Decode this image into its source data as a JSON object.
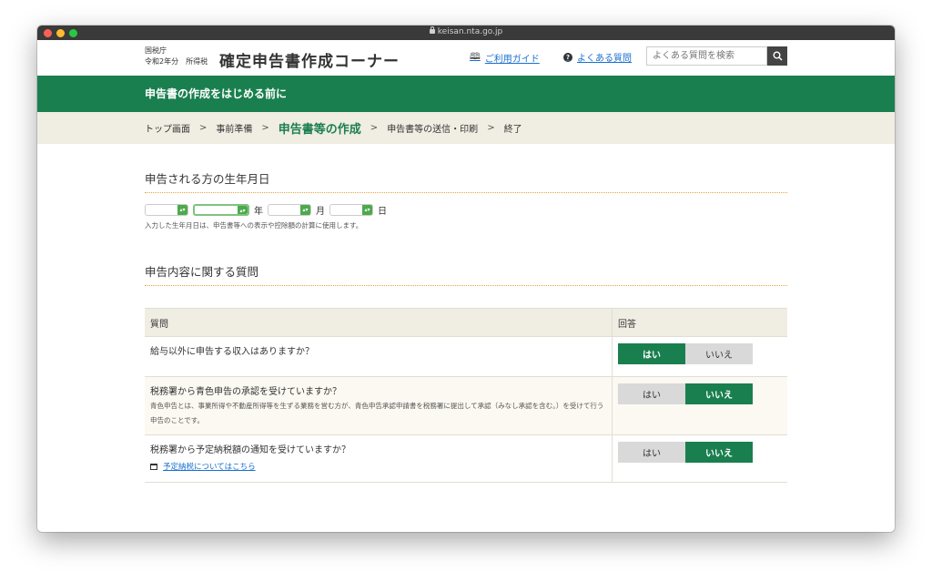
{
  "browser": {
    "url": "keisan.nta.go.jp"
  },
  "header": {
    "agency": "国税庁",
    "year_label": "令和2年分　所得税",
    "site_title": "確定申告書作成コーナー",
    "guide_link": "ご利用ガイド",
    "faq_link": "よくある質問",
    "search_placeholder": "よくある質問を検索"
  },
  "banner": {
    "title": "申告書の作成をはじめる前に"
  },
  "breadcrumb": {
    "steps": [
      "トップ画面",
      "事前準備",
      "申告書等の作成",
      "申告書等の送信・印刷",
      "終了"
    ],
    "current_index": 2,
    "separator": ">"
  },
  "birthdate": {
    "title": "申告される方の生年月日",
    "era_value": "",
    "year_value": "",
    "month_value": "",
    "day_value": "",
    "year_unit": "年",
    "month_unit": "月",
    "day_unit": "日",
    "note": "入力した生年月日は、申告書等への表示や控除額の計算に使用します。"
  },
  "questions": {
    "title": "申告内容に関する質問",
    "col_question": "質問",
    "col_answer": "回答",
    "yes_label": "はい",
    "no_label": "いいえ",
    "rows": [
      {
        "question": "給与以外に申告する収入はありますか？",
        "answer": "yes"
      },
      {
        "question": "税務署から青色申告の承認を受けていますか？",
        "desc": "青色申告とは、事業所得や不動産所得等を生ずる業務を営む方が、青色申告承認申請書を税務署に提出して承認（みなし承認を含む。）を受けて行う申告のことです。",
        "answer": "no"
      },
      {
        "question": "税務署から予定納税額の通知を受けていますか？",
        "link": "予定納税についてはこちら",
        "answer": "no"
      }
    ]
  },
  "colors": {
    "brand_green": "#1a7f4f",
    "beige": "#f0ede3",
    "link_blue": "#1a6fd0"
  }
}
